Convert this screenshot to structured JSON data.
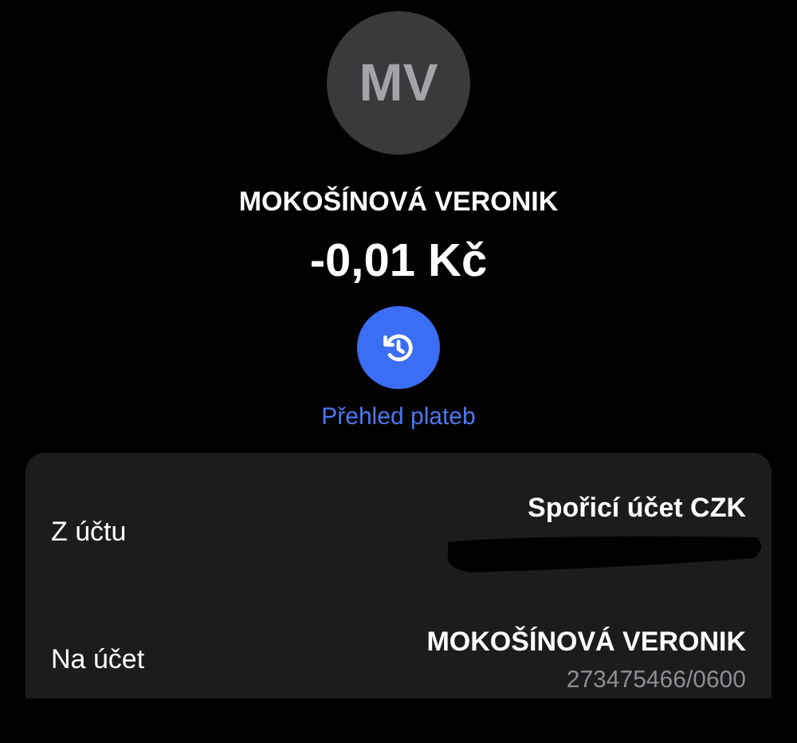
{
  "header": {
    "initials": "MV",
    "name": "MOKOŠÍNOVÁ VERONIK",
    "amount": "-0,01 Kč"
  },
  "action": {
    "label": "Přehled plateb"
  },
  "details": [
    {
      "label": "Z účtu",
      "value": "Spořicí účet CZK",
      "redacted": true
    },
    {
      "label": "Na účet",
      "value": "MOKOŠÍNOVÁ VERONIK",
      "detail": "273475466/0600",
      "redacted": false
    }
  ]
}
